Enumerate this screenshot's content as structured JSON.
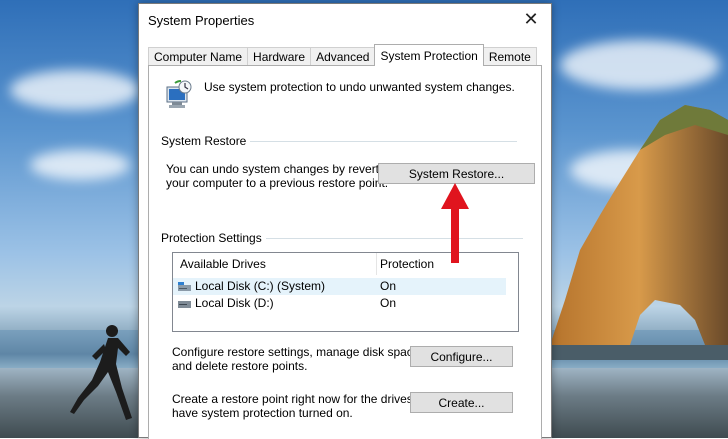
{
  "dialog": {
    "title": "System Properties",
    "close_glyph": "✕"
  },
  "tabs": [
    {
      "label": "Computer Name"
    },
    {
      "label": "Hardware"
    },
    {
      "label": "Advanced"
    },
    {
      "label": "System Protection",
      "active": true
    },
    {
      "label": "Remote"
    }
  ],
  "intro": {
    "icon": "system-protection-icon",
    "text": "Use system protection to undo unwanted system changes."
  },
  "system_restore": {
    "label": "System Restore",
    "description_line1": "You can undo system changes by reverting",
    "description_line2": "your computer to a previous restore point.",
    "button": "System Restore..."
  },
  "protection": {
    "label": "Protection Settings",
    "columns": [
      "Available Drives",
      "Protection"
    ],
    "drives": [
      {
        "name": "Local Disk (C:) (System)",
        "protection": "On",
        "icon": "system-disk-icon",
        "selected": true
      },
      {
        "name": "Local Disk (D:)",
        "protection": "On",
        "icon": "disk-icon",
        "selected": false
      }
    ],
    "configure_line1": "Configure restore settings, manage disk space,",
    "configure_line2": "and delete restore points.",
    "configure_button": "Configure...",
    "create_line1": "Create a restore point right now for the drives that",
    "create_line2": "have system protection turned on.",
    "create_button": "Create..."
  },
  "annotation": {
    "icon": "red-arrow-up-icon",
    "color": "#e0141e"
  }
}
